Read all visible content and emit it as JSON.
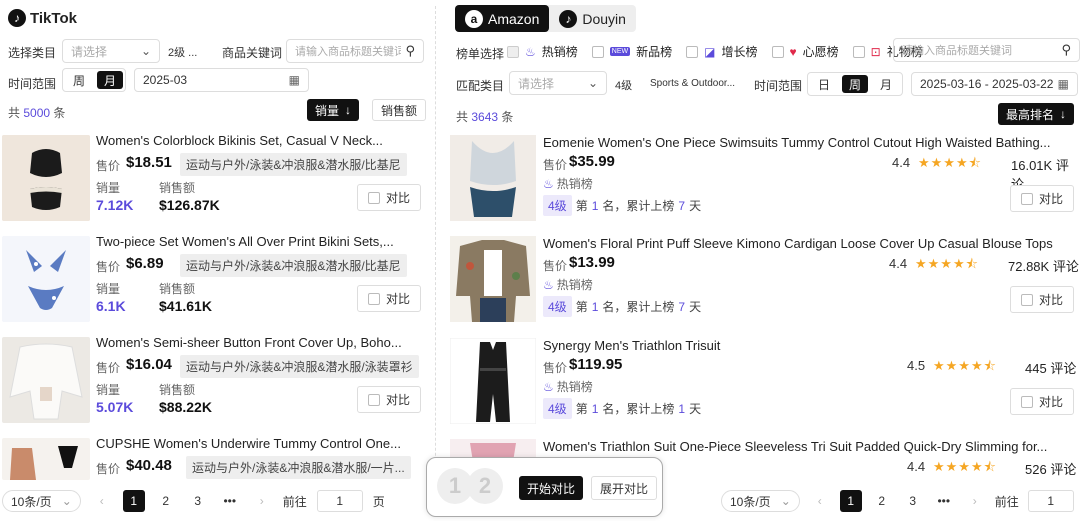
{
  "left": {
    "brand": "TikTok",
    "filters": {
      "category_label": "选择类目",
      "category_placeholder": "请选择",
      "level": "2级 ...",
      "keyword_label": "商品关键词",
      "keyword_placeholder": "请输入商品标题关键词",
      "time_label": "时间范围",
      "week": "周",
      "month": "月",
      "date": "2025-03"
    },
    "count_prefix": "共",
    "count": "5000",
    "count_suffix": "条",
    "sort_active": "销量",
    "sort_other": "销售额",
    "labels": {
      "price": "售价",
      "sales": "销量",
      "revenue": "销售额",
      "compare": "对比"
    },
    "items": [
      {
        "title": "Women's Colorblock Bikinis Set, Casual V Neck...",
        "price": "$18.51",
        "category": "运动与户外/泳装&冲浪服&潜水服/比基尼",
        "sales": "7.12K",
        "revenue": "$126.87K"
      },
      {
        "title": "Two-piece Set Women's All Over Print Bikini Sets,...",
        "price": "$6.89",
        "category": "运动与户外/泳装&冲浪服&潜水服/比基尼",
        "sales": "6.1K",
        "revenue": "$41.61K"
      },
      {
        "title": "Women's Semi-sheer Button Front Cover Up, Boho...",
        "price": "$16.04",
        "category": "运动与户外/泳装&冲浪服&潜水服/泳装罩衫",
        "sales": "5.07K",
        "revenue": "$88.22K"
      },
      {
        "title": "CUPSHE Women's Underwire Tummy Control One...",
        "price": "$40.48",
        "category": "运动与户外/泳装&冲浪服&潜水服/一片...",
        "sales": "",
        "revenue": ""
      }
    ],
    "pager": {
      "size": "10条/页",
      "pages": [
        "1",
        "2",
        "3",
        "•••"
      ],
      "goto": "前往",
      "goto_value": "1",
      "page_unit": "页"
    }
  },
  "right": {
    "tabs": [
      "Amazon",
      "Douyin"
    ],
    "list_label": "榜单选择",
    "lists": [
      "热销榜",
      "新品榜",
      "增长榜",
      "心愿榜",
      "礼物榜"
    ],
    "keyword_placeholder": "请输入商品标题关键词",
    "match_label": "匹配类目",
    "category_placeholder": "请选择",
    "level": "4级",
    "category_path": "Sports & Outdoor...",
    "time_label": "时间范围",
    "day": "日",
    "week": "周",
    "month": "月",
    "date_range": "2025-03-16 - 2025-03-22",
    "count_prefix": "共",
    "count": "3643",
    "count_suffix": "条",
    "sort": "最高排名",
    "labels": {
      "price": "售价",
      "hot": "热销榜",
      "reviews_unit": "评论",
      "rank_prefix": "第",
      "rank_mid": "名，累计上榜",
      "days": "天",
      "compare": "对比"
    },
    "items": [
      {
        "title": "Eomenie Women's One Piece Swimsuits Tummy Control Cutout High Waisted Bathing...",
        "price": "$35.99",
        "rating": "4.4",
        "stars": 4.4,
        "reviews": "16.01K",
        "level": "4级",
        "rank": "1",
        "days": "7"
      },
      {
        "title": "Women's Floral Print Puff Sleeve Kimono Cardigan Loose Cover Up Casual Blouse Tops",
        "price": "$13.99",
        "rating": "4.4",
        "stars": 4.4,
        "reviews": "72.88K",
        "level": "4级",
        "rank": "1",
        "days": "7"
      },
      {
        "title": "Synergy Men's Triathlon Trisuit",
        "price": "$119.95",
        "rating": "4.5",
        "stars": 4.5,
        "reviews": "445",
        "level": "4级",
        "rank": "1",
        "days": "1"
      },
      {
        "title": "Women's Triathlon Suit One-Piece Sleeveless Tri Suit Padded Quick-Dry Slimming for...",
        "price": "",
        "rating": "4.4",
        "stars": 4.4,
        "reviews": "526",
        "level": "",
        "rank": "",
        "days": ""
      }
    ],
    "pager": {
      "size": "10条/页",
      "pages": [
        "1",
        "2",
        "3",
        "•••"
      ],
      "goto": "前往",
      "goto_value": "1"
    }
  },
  "compare_bar": {
    "slot1": "1",
    "slot2": "2",
    "start": "开始对比",
    "expand": "展开对比"
  },
  "colors": {
    "accent": "#5b4bdb",
    "dark": "#111111",
    "star": "#f5a623"
  }
}
